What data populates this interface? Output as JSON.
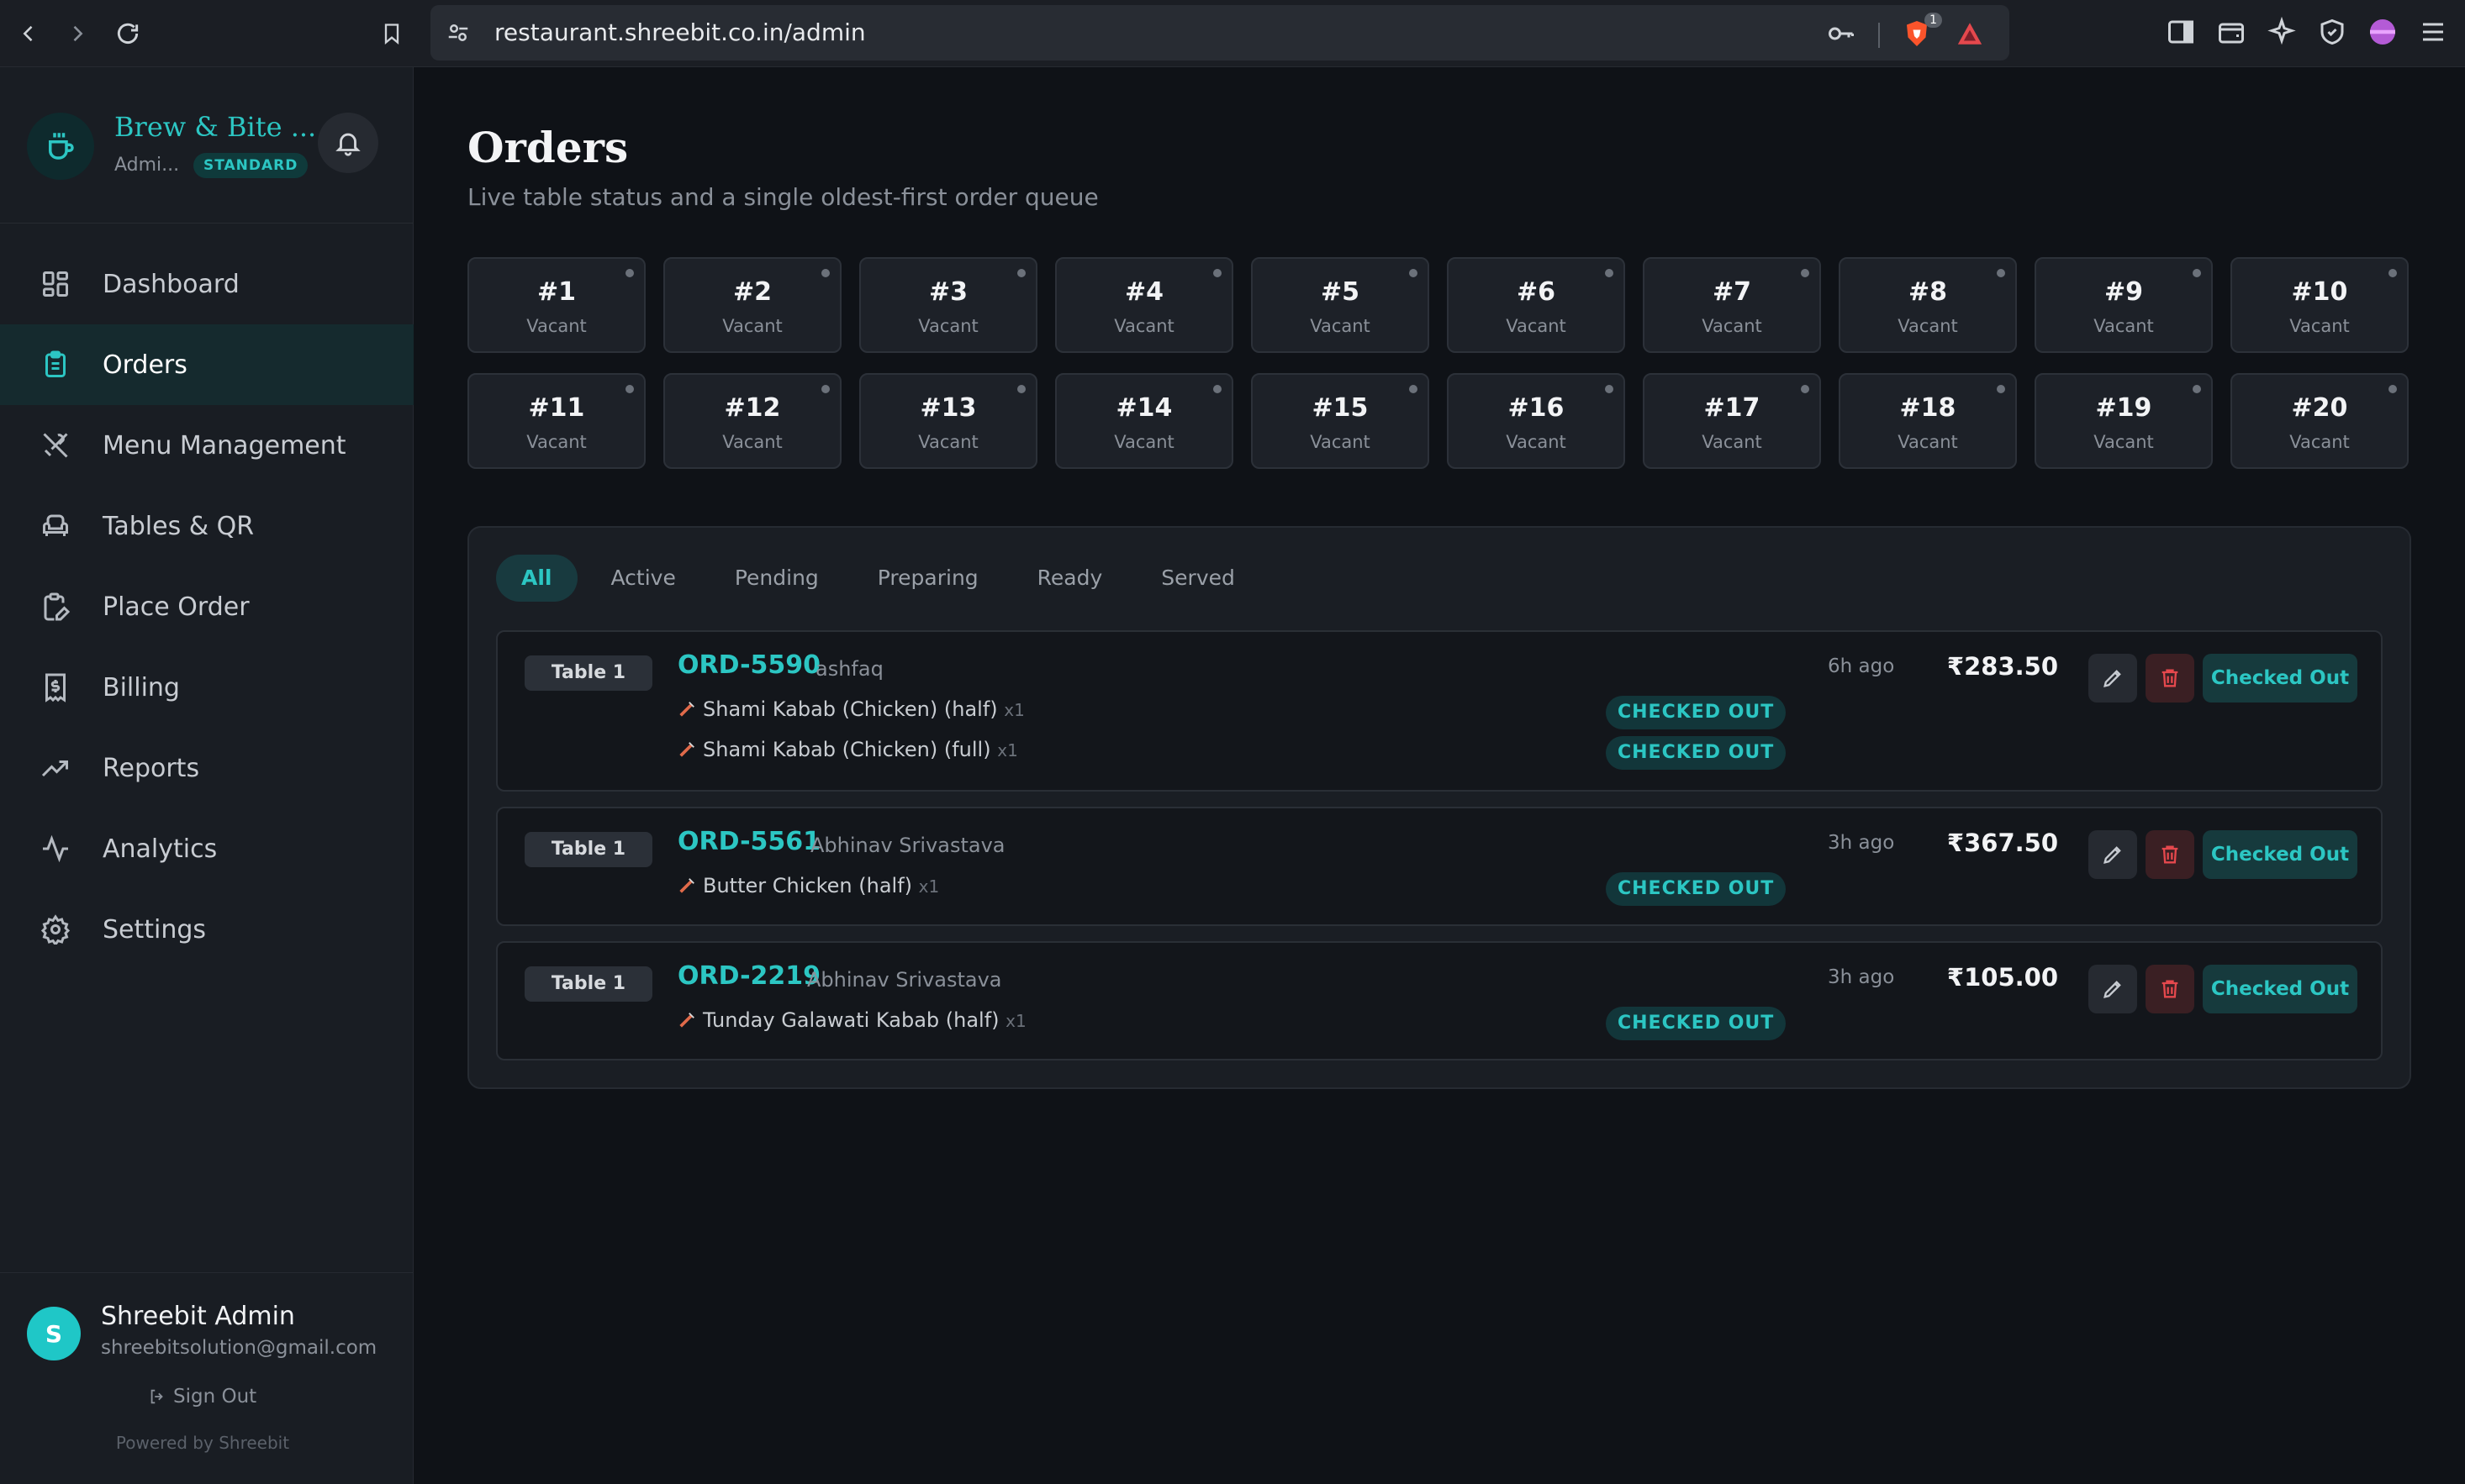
{
  "browser": {
    "url": "restaurant.shreebit.co.in/admin",
    "brave_badge_count": "1"
  },
  "sidebar": {
    "brand_name": "Brew & Bite ...",
    "role": "Admi...",
    "plan_badge": "STANDARD",
    "items": [
      {
        "label": "Dashboard",
        "icon": "grid-icon"
      },
      {
        "label": "Orders",
        "icon": "clipboard-icon",
        "active": true
      },
      {
        "label": "Menu Management",
        "icon": "utensils-icon"
      },
      {
        "label": "Tables & QR",
        "icon": "armchair-icon"
      },
      {
        "label": "Place Order",
        "icon": "clipboard-pen-icon"
      },
      {
        "label": "Billing",
        "icon": "receipt-icon"
      },
      {
        "label": "Reports",
        "icon": "trending-up-icon"
      },
      {
        "label": "Analytics",
        "icon": "activity-icon"
      },
      {
        "label": "Settings",
        "icon": "gear-icon"
      }
    ],
    "user": {
      "initial": "S",
      "name": "Shreebit Admin",
      "email": "shreebitsolution@gmail.com",
      "sign_out": "Sign Out",
      "powered_by": "Powered by Shreebit"
    }
  },
  "page": {
    "title": "Orders",
    "subtitle": "Live table status and a single oldest-first order queue"
  },
  "tables": [
    {
      "number": "#1",
      "status": "Vacant"
    },
    {
      "number": "#2",
      "status": "Vacant"
    },
    {
      "number": "#3",
      "status": "Vacant"
    },
    {
      "number": "#4",
      "status": "Vacant"
    },
    {
      "number": "#5",
      "status": "Vacant"
    },
    {
      "number": "#6",
      "status": "Vacant"
    },
    {
      "number": "#7",
      "status": "Vacant"
    },
    {
      "number": "#8",
      "status": "Vacant"
    },
    {
      "number": "#9",
      "status": "Vacant"
    },
    {
      "number": "#10",
      "status": "Vacant"
    },
    {
      "number": "#11",
      "status": "Vacant"
    },
    {
      "number": "#12",
      "status": "Vacant"
    },
    {
      "number": "#13",
      "status": "Vacant"
    },
    {
      "number": "#14",
      "status": "Vacant"
    },
    {
      "number": "#15",
      "status": "Vacant"
    },
    {
      "number": "#16",
      "status": "Vacant"
    },
    {
      "number": "#17",
      "status": "Vacant"
    },
    {
      "number": "#18",
      "status": "Vacant"
    },
    {
      "number": "#19",
      "status": "Vacant"
    },
    {
      "number": "#20",
      "status": "Vacant"
    }
  ],
  "filters": [
    "All",
    "Active",
    "Pending",
    "Preparing",
    "Ready",
    "Served"
  ],
  "active_filter": "All",
  "orders": [
    {
      "table": "Table 1",
      "id": "ORD-5590",
      "customer": "ashfaq",
      "time_ago": "6h ago",
      "amount": "₹283.50",
      "status_button": "Checked Out",
      "items": [
        {
          "name": "Shami Kabab (Chicken) (half)",
          "qty": "x1",
          "status": "CHECKED OUT"
        },
        {
          "name": "Shami Kabab (Chicken) (full)",
          "qty": "x1",
          "status": "CHECKED OUT"
        }
      ]
    },
    {
      "table": "Table 1",
      "id": "ORD-5561",
      "customer": "Abhinav Srivastava",
      "time_ago": "3h ago",
      "amount": "₹367.50",
      "status_button": "Checked Out",
      "items": [
        {
          "name": "Butter Chicken (half)",
          "qty": "x1",
          "status": "CHECKED OUT"
        }
      ]
    },
    {
      "table": "Table 1",
      "id": "ORD-2219",
      "customer": "Abhinav Srivastava",
      "time_ago": "3h ago",
      "amount": "₹105.00",
      "status_button": "Checked Out",
      "items": [
        {
          "name": "Tunday Galawati Kabab (half)",
          "qty": "x1",
          "status": "CHECKED OUT"
        }
      ]
    }
  ],
  "colors": {
    "accent": "#2cc6c3",
    "danger": "#e5484d",
    "background": "#0f1217",
    "panel": "#1a1e24"
  }
}
